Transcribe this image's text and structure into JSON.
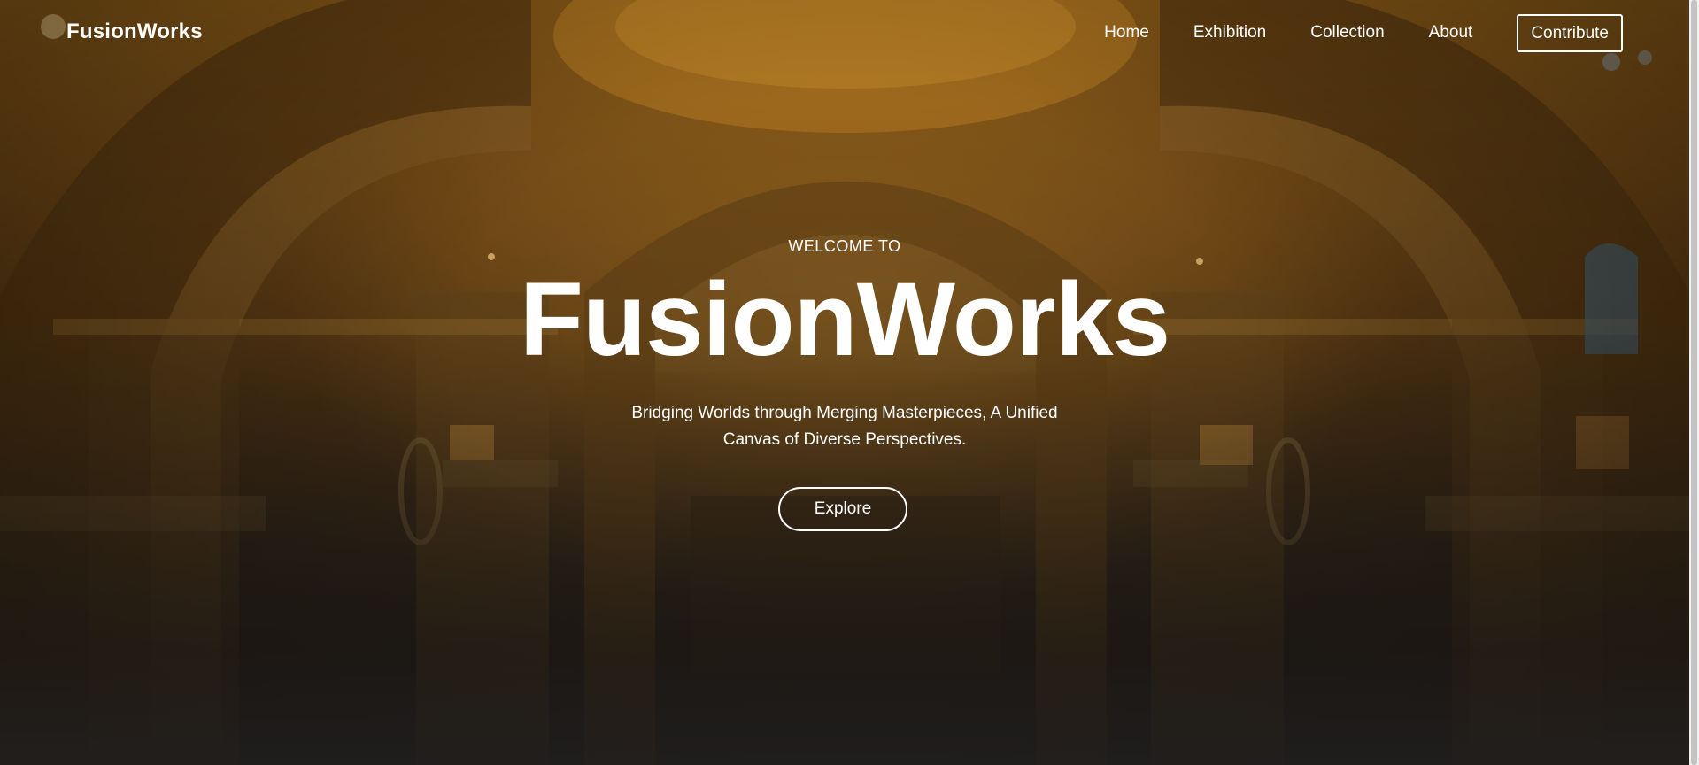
{
  "brand": {
    "name": "FusionWorks"
  },
  "nav": {
    "items": [
      {
        "label": "Home"
      },
      {
        "label": "Exhibition"
      },
      {
        "label": "Collection"
      },
      {
        "label": "About"
      }
    ],
    "cta_label": "Contribute"
  },
  "hero": {
    "kicker": "WELCOME TO",
    "title": "FusionWorks",
    "subtitle": "Bridging Worlds through Merging Masterpieces, A Unified Canvas of Diverse Perspectives.",
    "button_label": "Explore"
  },
  "background": {
    "image": "museum-hall-arches",
    "tint": "#8a5a17"
  }
}
